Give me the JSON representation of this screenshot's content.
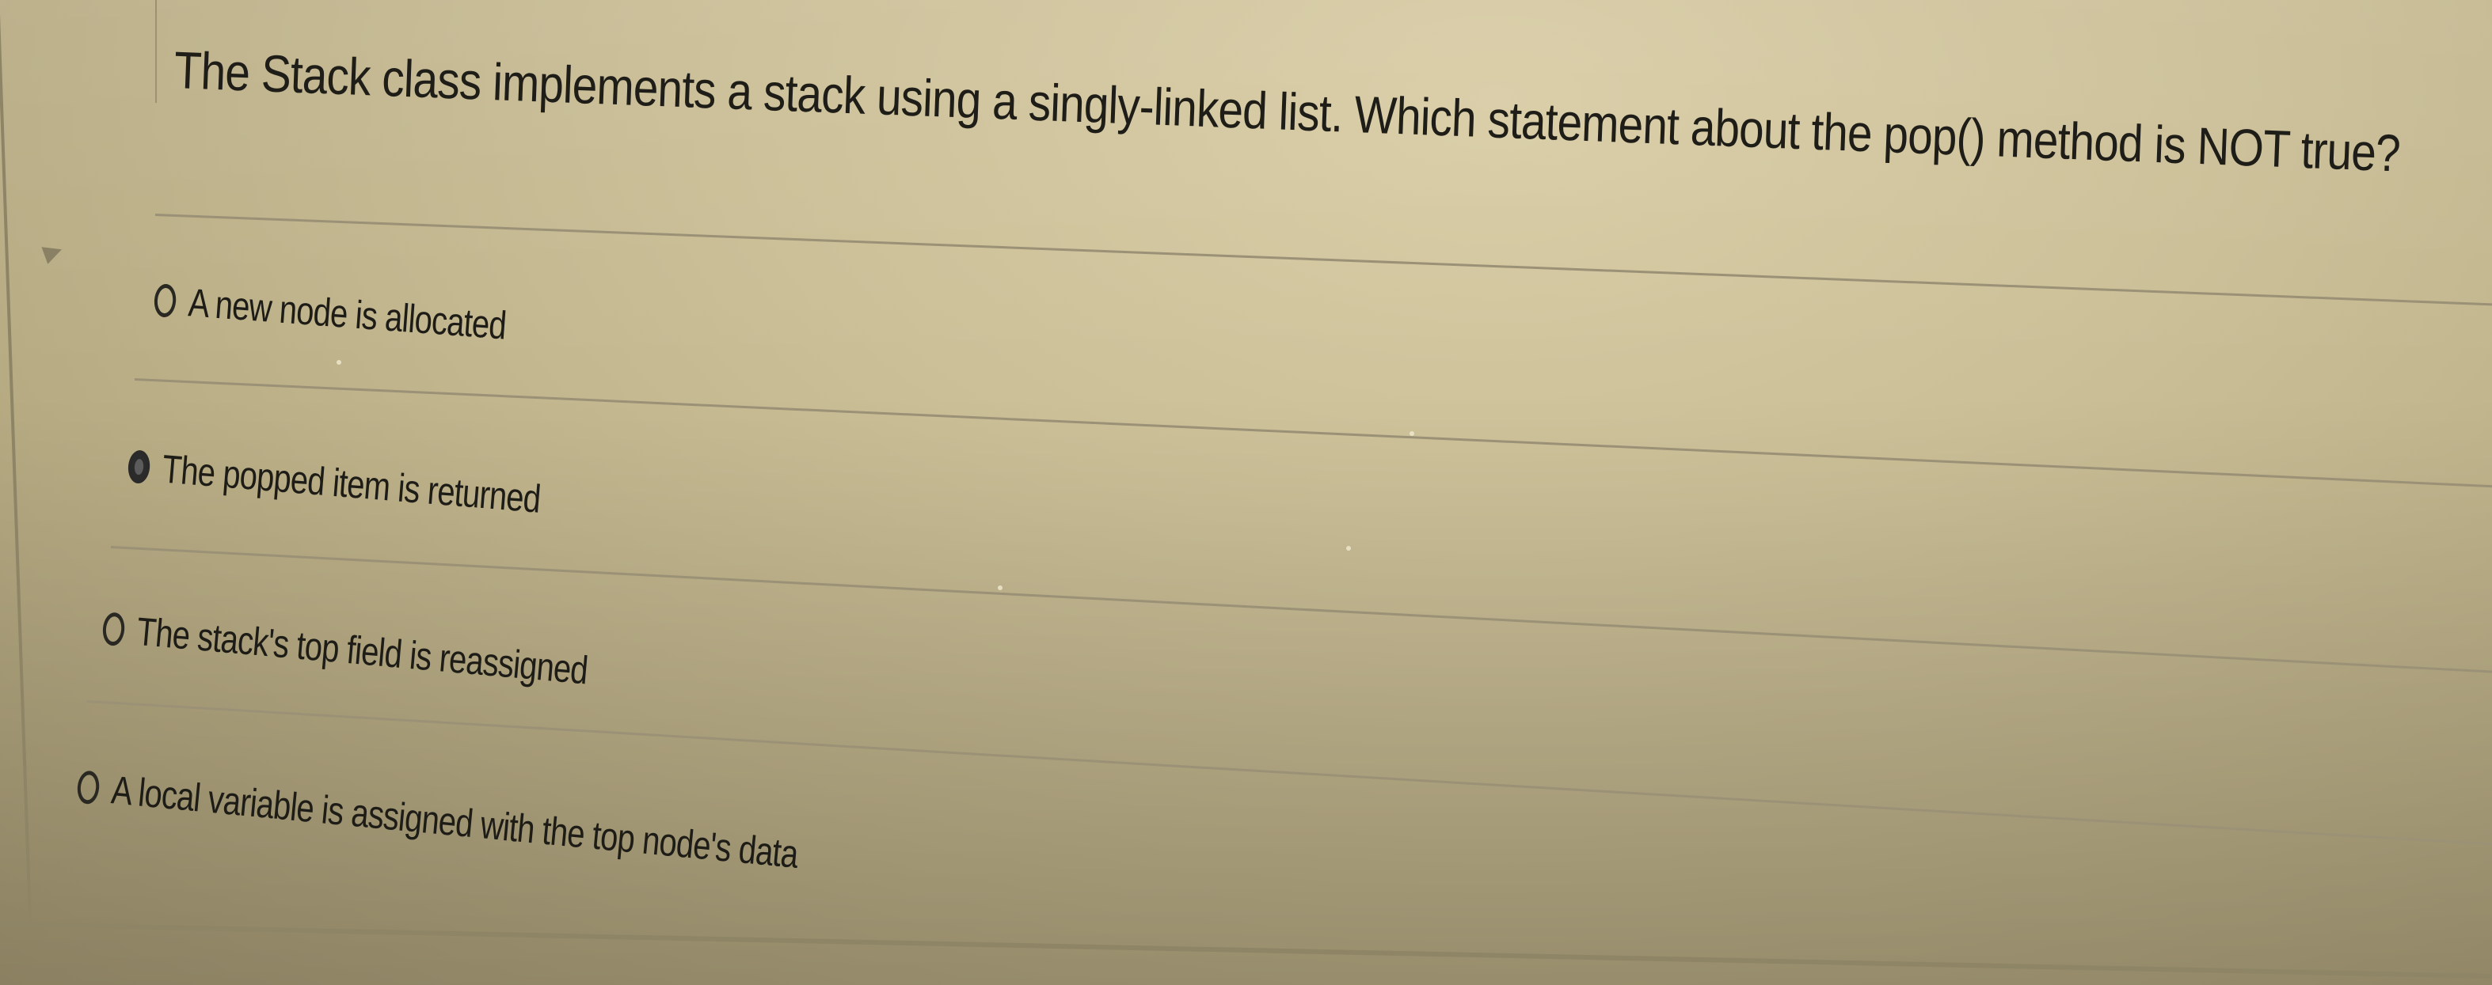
{
  "question": {
    "text": "The Stack class implements a stack using a singly-linked list. Which statement about the pop() method is NOT true?"
  },
  "options": [
    {
      "label": "A new node is allocated",
      "selected": false
    },
    {
      "label": "The popped item is returned",
      "selected": true
    },
    {
      "label": "The stack's top field is reassigned",
      "selected": false
    },
    {
      "label": "A local variable is assigned with the top node's data",
      "selected": false
    }
  ],
  "icons": {
    "radio_unchecked": "radio-unchecked-icon",
    "radio_checked": "radio-checked-icon"
  },
  "colors": {
    "background": "#cbbf97",
    "text": "#1f1d18"
  }
}
